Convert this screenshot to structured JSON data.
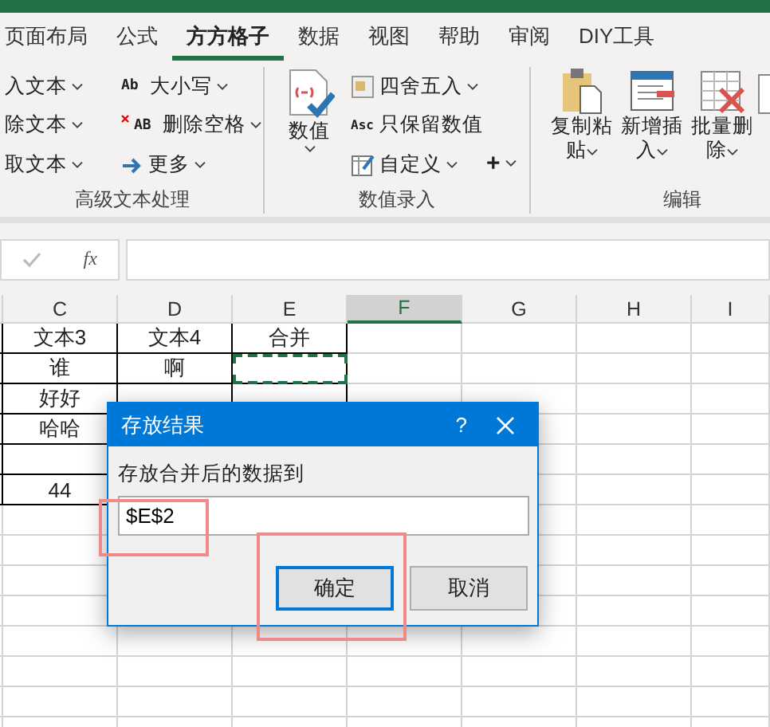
{
  "tabs": [
    {
      "label": "页面布局",
      "selected": false
    },
    {
      "label": "公式",
      "selected": false
    },
    {
      "label": "方方格子",
      "selected": true
    },
    {
      "label": "数据",
      "selected": false
    },
    {
      "label": "视图",
      "selected": false
    },
    {
      "label": "帮助",
      "selected": false
    },
    {
      "label": "审阅",
      "selected": false
    },
    {
      "label": "DIY工具",
      "selected": false
    }
  ],
  "ribbon": {
    "text_group": {
      "label": "高级文本处理",
      "items_left": [
        "入文本",
        "除文本",
        "取文本"
      ],
      "items_right": [
        {
          "badge": "Ab",
          "label": "大小写"
        },
        {
          "badge": "AB",
          "label": "删除空格"
        },
        {
          "label": "更多"
        }
      ]
    },
    "number_group": {
      "label": "数值录入",
      "big_button": "数值",
      "items": [
        {
          "label": "四舍五入"
        },
        {
          "badge": "Asc",
          "label": "只保留数值"
        },
        {
          "label": "自定义"
        }
      ],
      "plus": "+"
    },
    "edit_group": {
      "label": "编辑",
      "buttons": [
        "复制粘贴",
        "新增插入",
        "批量删除"
      ]
    }
  },
  "formula_bar": {
    "fx": "fx"
  },
  "sheet": {
    "columns": [
      {
        "label": "C",
        "selected": false
      },
      {
        "label": "D",
        "selected": false
      },
      {
        "label": "E",
        "selected": false
      },
      {
        "label": "F",
        "selected": true
      },
      {
        "label": "G",
        "selected": false
      },
      {
        "label": "H",
        "selected": false
      },
      {
        "label": "I",
        "selected": false
      }
    ],
    "rows": [
      {
        "bordered": true,
        "C": "文本3",
        "D": "文本4",
        "E": "合并"
      },
      {
        "bordered": true,
        "C": "谁",
        "D": "啊",
        "e_copy_marquee": true
      },
      {
        "bordered": true,
        "C": "好好"
      },
      {
        "bordered": true,
        "C": "哈哈"
      },
      {
        "bordered": true
      },
      {
        "bordered": true,
        "C": "44"
      }
    ]
  },
  "dialog": {
    "title": "存放结果",
    "help": "?",
    "label": "存放合并后的数据到",
    "value": "$E$2",
    "buttons": [
      {
        "label": "确定",
        "default": true
      },
      {
        "label": "取消",
        "default": false
      }
    ]
  }
}
